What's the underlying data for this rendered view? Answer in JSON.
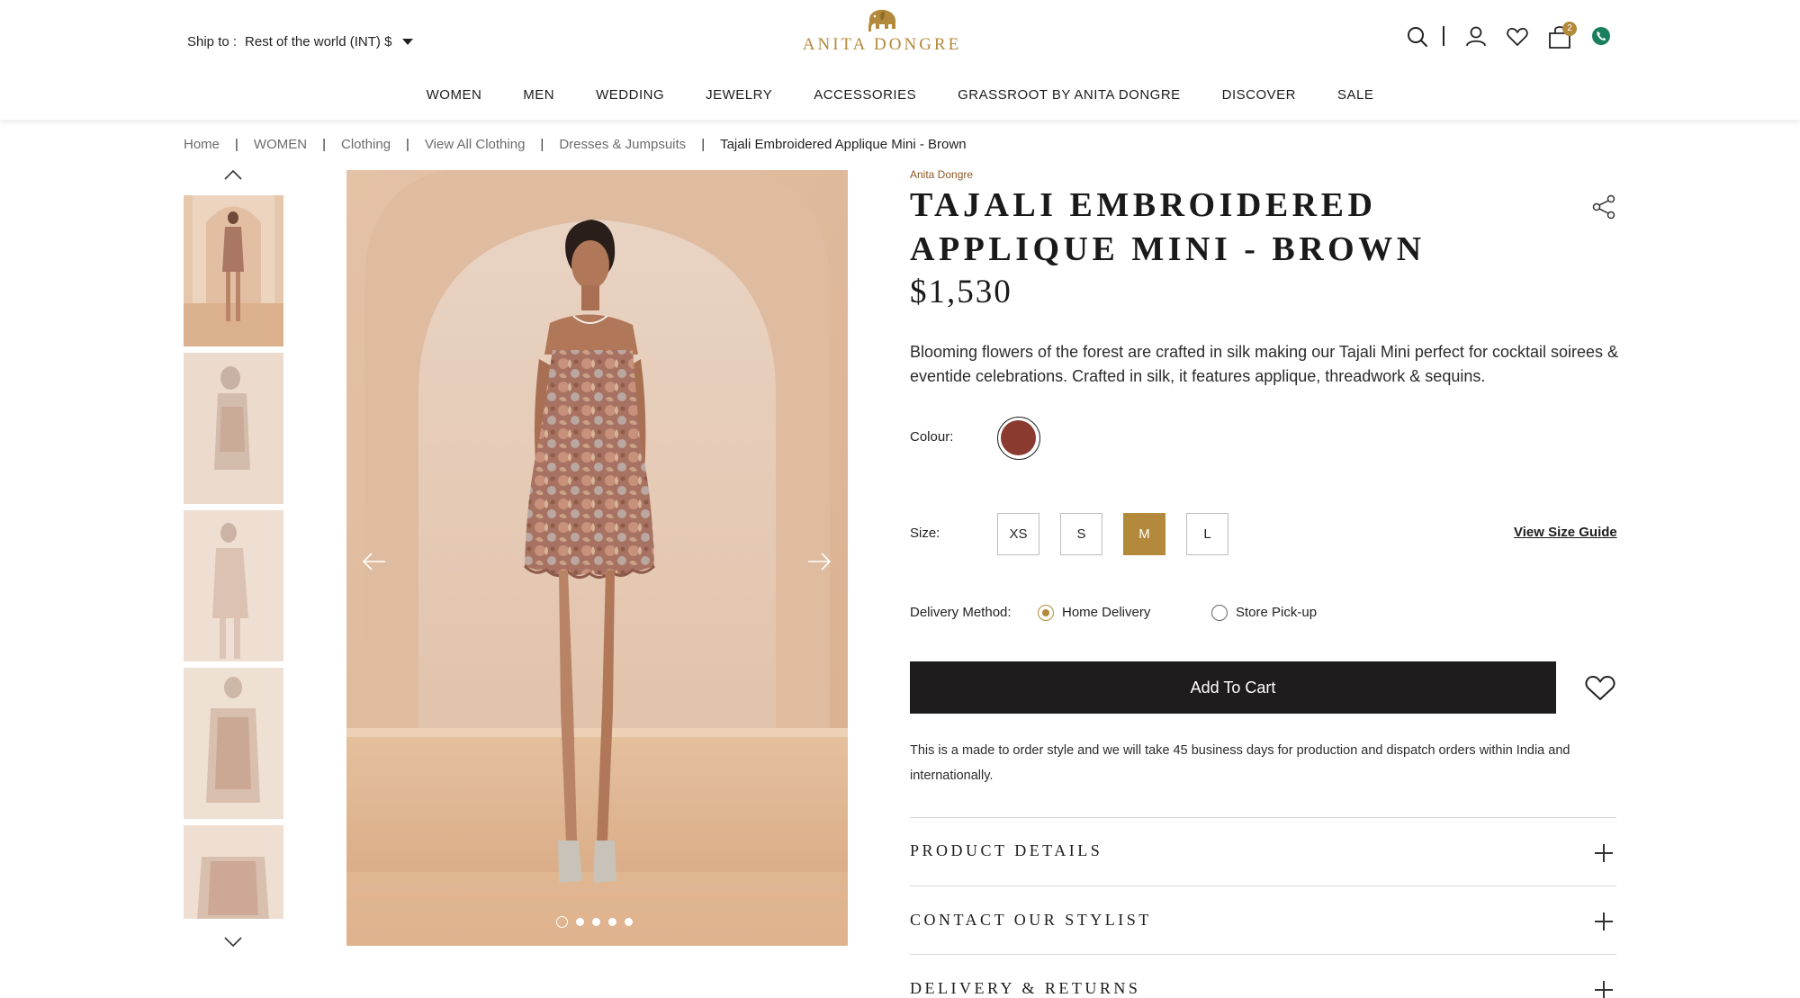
{
  "header": {
    "ship_label": "Ship to :",
    "ship_value": "Rest of the world (INT) $",
    "logo_text": "ANITA DONGRE",
    "cart_count": "2",
    "icons": [
      "search-icon",
      "user-icon",
      "heart-icon",
      "shopping-bag-icon",
      "whatsapp-icon"
    ]
  },
  "nav": [
    "WOMEN",
    "MEN",
    "WEDDING",
    "JEWELRY",
    "ACCESSORIES",
    "GRASSROOT BY ANITA DONGRE",
    "DISCOVER",
    "SALE"
  ],
  "breadcrumb": [
    "Home",
    "WOMEN",
    "Clothing",
    "View All Clothing",
    "Dresses & Jumpsuits",
    "Tajali Embroidered Applique Mini - Brown"
  ],
  "product": {
    "brand": "Anita Dongre",
    "title": "TAJALI EMBROIDERED APPLIQUE MINI - BROWN",
    "price": "$1,530",
    "description": "Blooming flowers of the forest are crafted in silk making our Tajali Mini perfect for cocktail soirees & eventide celebrations. Crafted in silk, it features applique, threadwork & sequins.",
    "colour_label": "Colour:",
    "colour_hex": "#8b3a2f",
    "size_label": "Size:",
    "sizes": [
      "XS",
      "S",
      "M",
      "L"
    ],
    "selected_size": "M",
    "size_guide": "View Size Guide",
    "delivery_label": "Delivery Method:",
    "delivery_options": [
      "Home Delivery",
      "Store Pick-up"
    ],
    "selected_delivery": "Home Delivery",
    "add_to_cart": "Add To Cart",
    "note": "This is a made to order style and we will take 45 business days for production and dispatch orders within India and internationally."
  },
  "accordion": [
    "PRODUCT DETAILS",
    "CONTACT OUR STYLIST",
    "DELIVERY & RETURNS"
  ],
  "gallery": {
    "image_count": 5,
    "active_index": 0
  },
  "colors": {
    "accent_gold": "#b3893b",
    "button_dark": "#1e1c1d",
    "backdrop": "#e8cbb4"
  }
}
